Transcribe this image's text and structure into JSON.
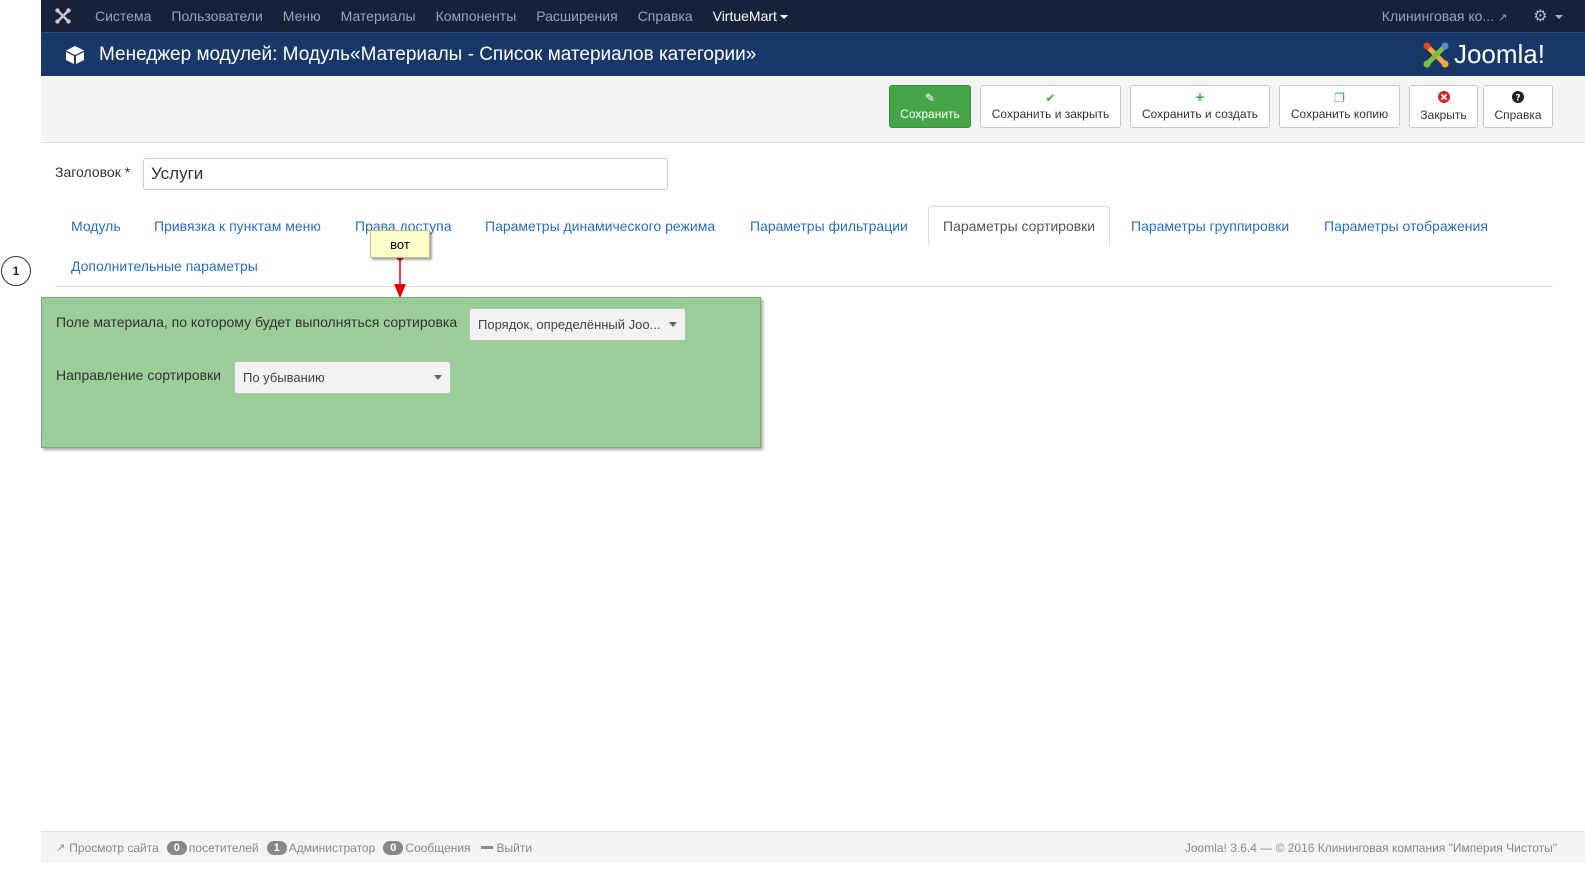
{
  "topnav": {
    "logo_icon": "joomla-icon",
    "menu": [
      "Система",
      "Пользователи",
      "Меню",
      "Материалы",
      "Компоненты",
      "Расширения",
      "Справка",
      "VirtueMart"
    ],
    "site_name": "Клининговая ко...",
    "settings_icon": "gear-icon"
  },
  "header": {
    "title": "Менеджер модулей: Модуль«Материалы - Список материалов категории»",
    "brand": "Joomla!"
  },
  "toolbar": {
    "save": "Сохранить",
    "save_close": "Сохранить и закрыть",
    "save_new": "Сохранить и создать",
    "save_copy": "Сохранить копию",
    "close": "Закрыть",
    "help": "Справка"
  },
  "form": {
    "title_label": "Заголовок *",
    "title_value": "Услуги"
  },
  "tabs": [
    "Модуль",
    "Привязка к пунктам меню",
    "Права доступа",
    "Параметры динамического режима",
    "Параметры фильтрации",
    "Параметры сортировки",
    "Параметры группировки",
    "Параметры отображения",
    "Дополнительные параметры"
  ],
  "active_tab": "Параметры сортировки",
  "annotation": {
    "number": "1",
    "note": "вот"
  },
  "sorting": {
    "field_label": "Поле материала, по которому будет выполняться сортировка",
    "field_value": "Порядок, определённый Joo...",
    "direction_label": "Направление сортировки",
    "direction_value": "По убыванию"
  },
  "footer": {
    "view_site": "Просмотр сайта",
    "visitors_count": "0",
    "visitors_label": "посетителей",
    "admins_count": "1",
    "admins_label": "Администратор",
    "messages_count": "0",
    "messages_label": "Сообщения",
    "logout": "Выйти",
    "copyright": "Joomla! 3.6.4  —  © 2016 Клининговая компания \"Империя Чистоты\""
  },
  "colors": {
    "topnav_bg": "#17233a",
    "header_bg": "#1a3867",
    "save_green": "#46a546",
    "panel_green": "#9acd97",
    "link_blue": "#2a6ebb",
    "annotation_red": "#e00000"
  }
}
